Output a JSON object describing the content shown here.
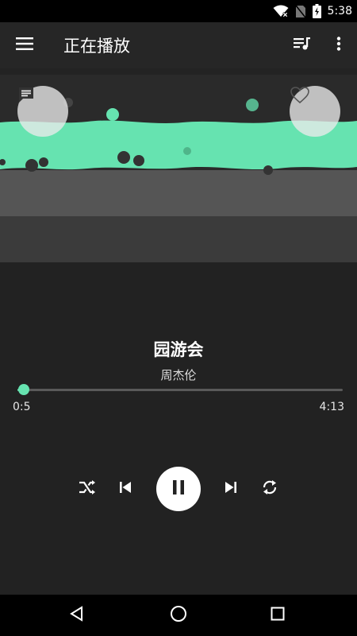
{
  "status_bar": {
    "time": "5:38",
    "icons": [
      "wifi-off-icon",
      "no-sim-icon",
      "battery-charging-icon"
    ]
  },
  "app_bar": {
    "title": "正在播放",
    "left_icon": "menu-icon",
    "right_icons": [
      "queue-music-icon",
      "more-vert-icon"
    ]
  },
  "visualizer": {
    "left_button_icon": "comment-icon",
    "right_button_icon": "heart-outline-icon",
    "accent_color": "#66e3b0"
  },
  "track": {
    "title": "园游会",
    "artist": "周杰伦",
    "current_time": "0:5",
    "total_time": "4:13",
    "progress_fraction": 0.02
  },
  "controls": {
    "icons": [
      "shuffle-icon",
      "skip-previous-icon",
      "pause-icon",
      "skip-next-icon",
      "repeat-icon"
    ]
  },
  "nav_bar": {
    "icons": [
      "back-icon",
      "home-icon",
      "recents-icon"
    ]
  }
}
